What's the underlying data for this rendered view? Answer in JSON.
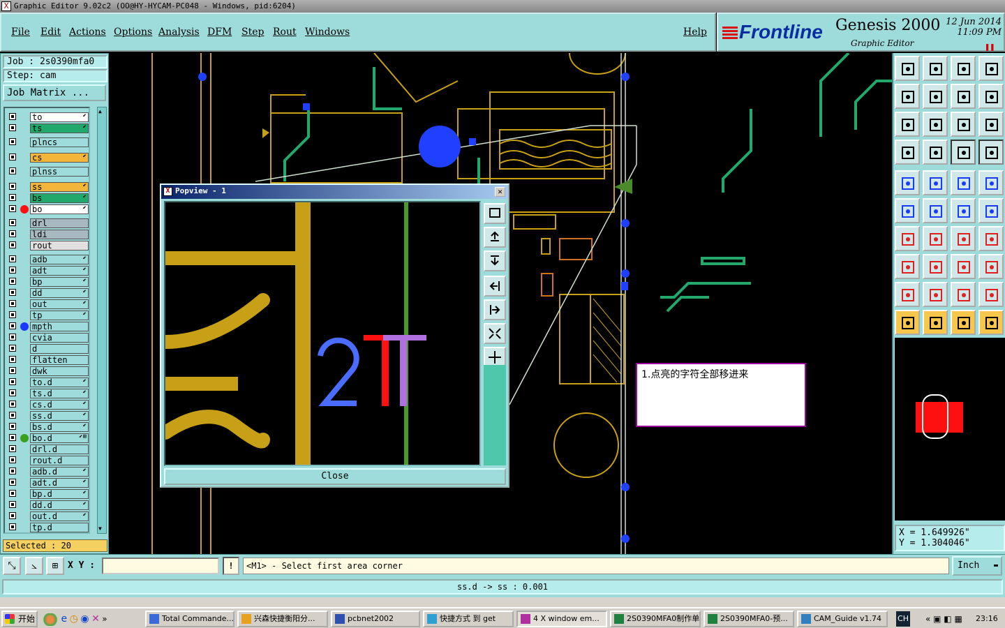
{
  "window": {
    "title": "Graphic Editor 9.02c2 (OO@HY-HYCAM-PC048 - Windows, pid:6204)"
  },
  "menu": {
    "file": "File",
    "edit": "Edit",
    "actions": "Actions",
    "options": "Options",
    "analysis": "Analysis",
    "dfm": "DFM",
    "step": "Step",
    "rout": "Rout",
    "windows": "Windows",
    "help": "Help"
  },
  "brand": {
    "logo": "Frontline",
    "product": "Genesis 2000",
    "subtitle": "Graphic Editor",
    "date": "12 Jun 2014",
    "time": "11:09 PM"
  },
  "job": {
    "job_label": "Job : 2s0390mfa0",
    "step_label": "Step: cam",
    "matrix_button": "Job Matrix ..."
  },
  "layers": [
    {
      "name": "to",
      "color": "#ffffff",
      "flag": "⬋"
    },
    {
      "name": "ts",
      "color": "#23a86b",
      "flag": "⬋"
    },
    {
      "name": "plncs",
      "color": "#9edcdc",
      "flag": ""
    },
    {
      "name": "cs",
      "color": "#f4b63a",
      "flag": "⬋"
    },
    {
      "name": "plnss",
      "color": "#9edcdc",
      "flag": ""
    },
    {
      "name": "ss",
      "color": "#f4b63a",
      "flag": "⬋"
    },
    {
      "name": "bs",
      "color": "#23a86b",
      "flag": "⬋"
    },
    {
      "name": "bo",
      "color": "#ffffff",
      "flag": "⬋",
      "dot": "#ff1010"
    },
    {
      "name": "drl",
      "color": "#a8b8c0",
      "flag": ""
    },
    {
      "name": "ldi",
      "color": "#a8b8c0",
      "flag": ""
    },
    {
      "name": "rout",
      "color": "#e0e0e0",
      "flag": ""
    },
    {
      "name": "adb",
      "color": "#9edcdc",
      "flag": "⬋"
    },
    {
      "name": "adt",
      "color": "#9edcdc",
      "flag": "⬋"
    },
    {
      "name": "bp",
      "color": "#9edcdc",
      "flag": "⬋"
    },
    {
      "name": "dd",
      "color": "#9edcdc",
      "flag": "⬋"
    },
    {
      "name": "out",
      "color": "#9edcdc",
      "flag": "⬋"
    },
    {
      "name": "tp",
      "color": "#9edcdc",
      "flag": "⬋"
    },
    {
      "name": "mpth",
      "color": "#9edcdc",
      "flag": "",
      "dot": "#1a3aff"
    },
    {
      "name": "cvia",
      "color": "#9edcdc",
      "flag": ""
    },
    {
      "name": "d",
      "color": "#9edcdc",
      "flag": ""
    },
    {
      "name": "flatten",
      "color": "#9edcdc",
      "flag": ""
    },
    {
      "name": "dwk",
      "color": "#9edcdc",
      "flag": ""
    },
    {
      "name": "to.d",
      "color": "#9edcdc",
      "flag": "⬋"
    },
    {
      "name": "ts.d",
      "color": "#9edcdc",
      "flag": "⬋"
    },
    {
      "name": "cs.d",
      "color": "#9edcdc",
      "flag": "⬋"
    },
    {
      "name": "ss.d",
      "color": "#9edcdc",
      "flag": "⬋"
    },
    {
      "name": "bs.d",
      "color": "#9edcdc",
      "flag": "⬋"
    },
    {
      "name": "bo.d",
      "color": "#9edcdc",
      "flag": "⬋⊞",
      "dot": "#3aa020"
    },
    {
      "name": "drl.d",
      "color": "#9edcdc",
      "flag": ""
    },
    {
      "name": "rout.d",
      "color": "#9edcdc",
      "flag": ""
    },
    {
      "name": "adb.d",
      "color": "#9edcdc",
      "flag": "⬋"
    },
    {
      "name": "adt.d",
      "color": "#9edcdc",
      "flag": "⬋"
    },
    {
      "name": "bp.d",
      "color": "#9edcdc",
      "flag": "⬋"
    },
    {
      "name": "dd.d",
      "color": "#9edcdc",
      "flag": "⬋"
    },
    {
      "name": "out.d",
      "color": "#9edcdc",
      "flag": "⬋"
    },
    {
      "name": "tp.d",
      "color": "#9edcdc",
      "flag": ""
    }
  ],
  "selected": "Selected : 20",
  "popview": {
    "title": "Popview - 1",
    "close_label": "Close"
  },
  "note": {
    "text": "1.点亮的字符全部移进来"
  },
  "coords": {
    "x": "X = 1.649926\"",
    "y": "Y = 1.304046\""
  },
  "cmd": {
    "xy_label": "X Y :",
    "xy_value": "",
    "excl": "!",
    "prompt": "<M1> - Select first area corner",
    "units": "Inch"
  },
  "status": {
    "text": "ss.d -> ss : 0.001"
  },
  "taskbar": {
    "start": "开始",
    "tasks": [
      "Total Commande...",
      "兴森快捷衡阳分...",
      "pcbnet2002",
      "快捷方式 到 get",
      "4 X window em...",
      "2S0390MFA0制作单",
      "2S0390MFA0-预...",
      "CAM_Guide v1.74"
    ],
    "lang": "CH",
    "clock": "23:16"
  },
  "colors": {
    "panel": "#9edcdc",
    "accent": "#f4b63a",
    "silk": "#c8a018"
  }
}
